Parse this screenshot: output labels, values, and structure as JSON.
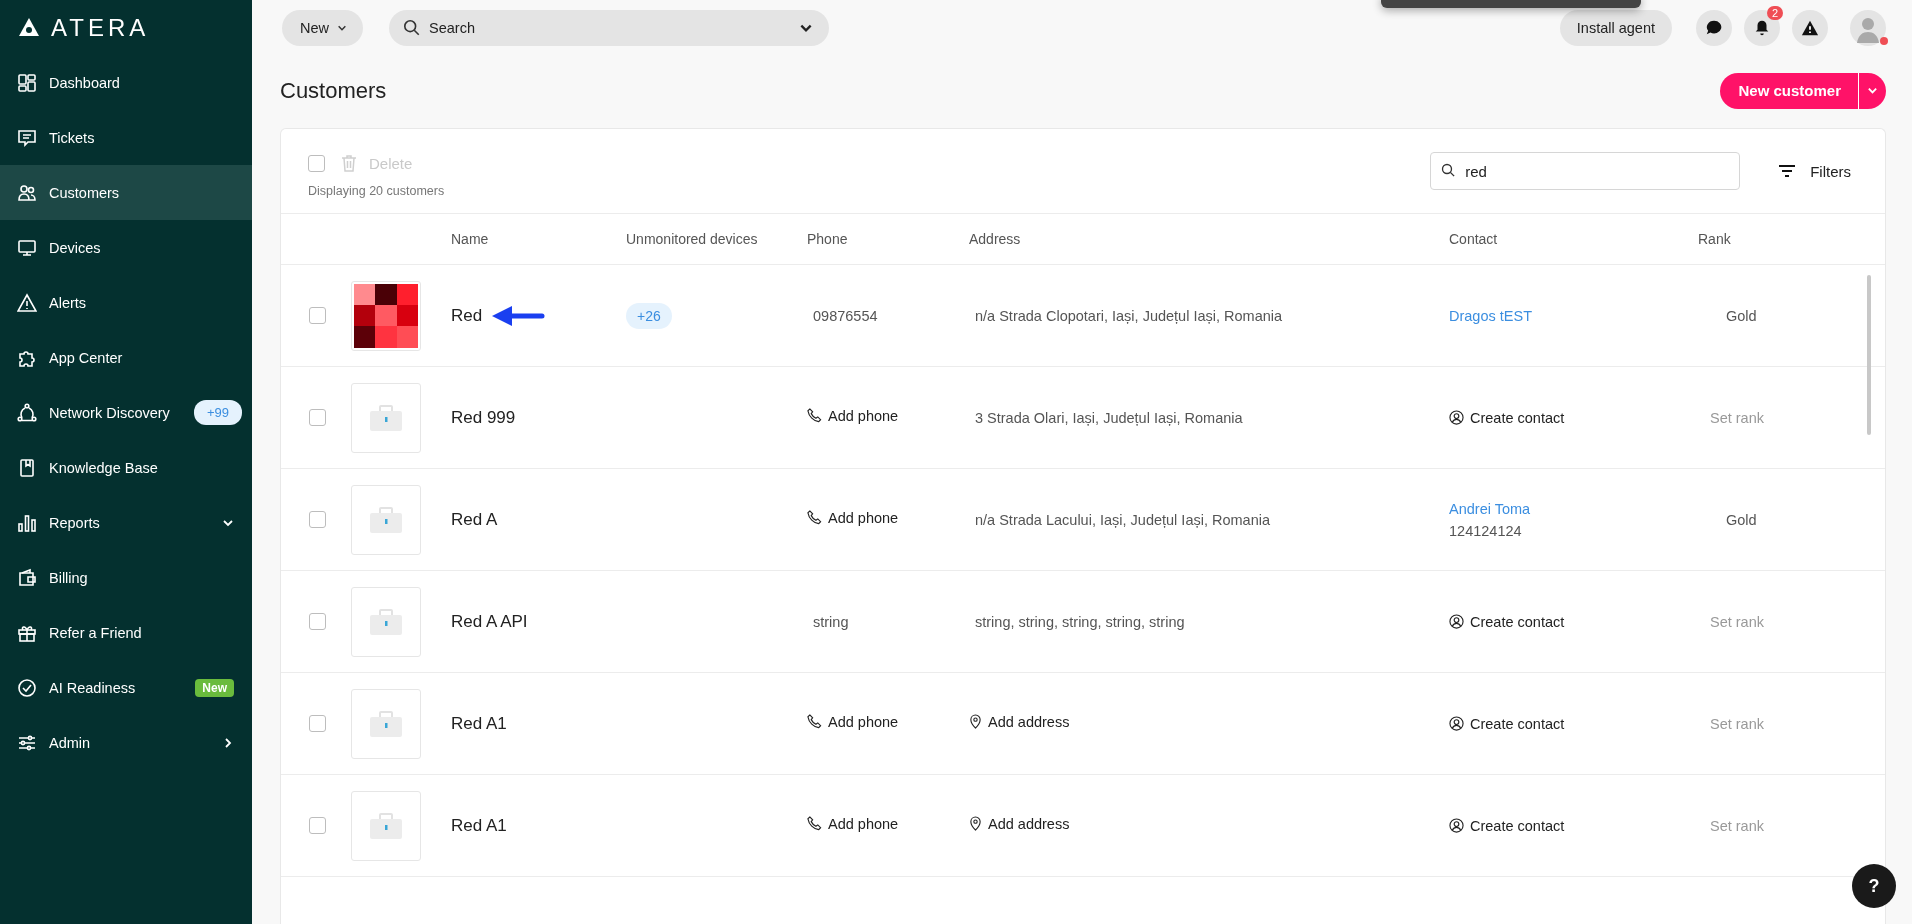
{
  "brand": {
    "name": "ATERA"
  },
  "sidebar": {
    "items": [
      {
        "label": "Dashboard",
        "kind": "dashboard",
        "selected": false
      },
      {
        "label": "Tickets",
        "kind": "tickets",
        "selected": false
      },
      {
        "label": "Customers",
        "kind": "customers",
        "selected": true
      },
      {
        "label": "Devices",
        "kind": "devices",
        "selected": false
      },
      {
        "label": "Alerts",
        "kind": "alerts",
        "selected": false
      },
      {
        "label": "App Center",
        "kind": "apps",
        "selected": false
      },
      {
        "label": "Network Discovery",
        "kind": "network",
        "selected": false,
        "badge": {
          "kind": "count",
          "text": "+99"
        }
      },
      {
        "label": "Knowledge Base",
        "kind": "book",
        "selected": false
      },
      {
        "label": "Reports",
        "kind": "reports",
        "selected": false
      },
      {
        "label": "Billing",
        "kind": "wallet",
        "selected": false
      },
      {
        "label": "Refer a Friend",
        "kind": "gift",
        "selected": false
      },
      {
        "label": "AI Readiness",
        "kind": "check",
        "selected": false,
        "badge": {
          "kind": "new",
          "text": "New"
        }
      },
      {
        "label": "Admin",
        "kind": "sliders",
        "selected": false
      }
    ]
  },
  "topbar": {
    "new_button": "New",
    "search": {
      "placeholder": "Search"
    },
    "install_agent": "Install agent",
    "notifications_count": "2",
    "user_status_dot": true
  },
  "page": {
    "title": "Customers",
    "new_customer_button": "New customer"
  },
  "toolbar": {
    "select_all_checked": false,
    "delete": {
      "label": "Delete",
      "disabled": true
    },
    "count_text": "Displaying 20 customers",
    "search": {
      "value": "red"
    },
    "filters": "Filters"
  },
  "table": {
    "columns": [
      "Name",
      "Unmonitored devices",
      "Phone",
      "Address",
      "Contact",
      "Rank"
    ],
    "rows": [
      {
        "checked": false,
        "kind": "logo",
        "name": "Red",
        "annotated": true,
        "devices": "+26",
        "phone": {
          "kind": "value",
          "text": "09876554"
        },
        "address": {
          "kind": "value",
          "text": "n/a Strada Clopotari, Iași, Județul Iași, Romania"
        },
        "contact": {
          "kind": "link",
          "text": "Dragos tEST"
        },
        "rank": {
          "kind": "value",
          "text": "Gold"
        }
      },
      {
        "checked": false,
        "kind": "default",
        "name": "Red 999",
        "annotated": false,
        "phone": {
          "kind": "action",
          "text": "Add phone"
        },
        "address": {
          "kind": "value",
          "text": "3 Strada Olari, Iași, Județul Iași, Romania"
        },
        "contact": {
          "kind": "action",
          "text": "Create contact"
        },
        "rank": {
          "kind": "action",
          "text": "Set rank"
        }
      },
      {
        "checked": false,
        "kind": "default",
        "name": "Red A",
        "annotated": false,
        "phone": {
          "kind": "action",
          "text": "Add phone"
        },
        "address": {
          "kind": "value",
          "text": "n/a Strada Lacului, Iași, Județul Iași, Romania"
        },
        "contact": {
          "kind": "link",
          "text": "Andrei Toma",
          "phone": "124124124"
        },
        "rank": {
          "kind": "value",
          "text": "Gold"
        }
      },
      {
        "checked": false,
        "kind": "default",
        "name": "Red A API",
        "annotated": false,
        "phone": {
          "kind": "value",
          "text": "string"
        },
        "address": {
          "kind": "value",
          "text": "string, string, string, string, string"
        },
        "contact": {
          "kind": "action",
          "text": "Create contact"
        },
        "rank": {
          "kind": "action",
          "text": "Set rank"
        }
      },
      {
        "checked": false,
        "kind": "default",
        "name": "Red A1",
        "annotated": false,
        "phone": {
          "kind": "action",
          "text": "Add phone"
        },
        "address": {
          "kind": "action",
          "text": "Add address"
        },
        "contact": {
          "kind": "action",
          "text": "Create contact"
        },
        "rank": {
          "kind": "action",
          "text": "Set rank"
        }
      },
      {
        "checked": false,
        "kind": "default",
        "name": "Red A1",
        "annotated": false,
        "phone": {
          "kind": "action",
          "text": "Add phone"
        },
        "address": {
          "kind": "action",
          "text": "Add address"
        },
        "contact": {
          "kind": "action",
          "text": "Create contact"
        },
        "rank": {
          "kind": "action",
          "text": "Set rank"
        }
      }
    ]
  },
  "help_button": "?"
}
